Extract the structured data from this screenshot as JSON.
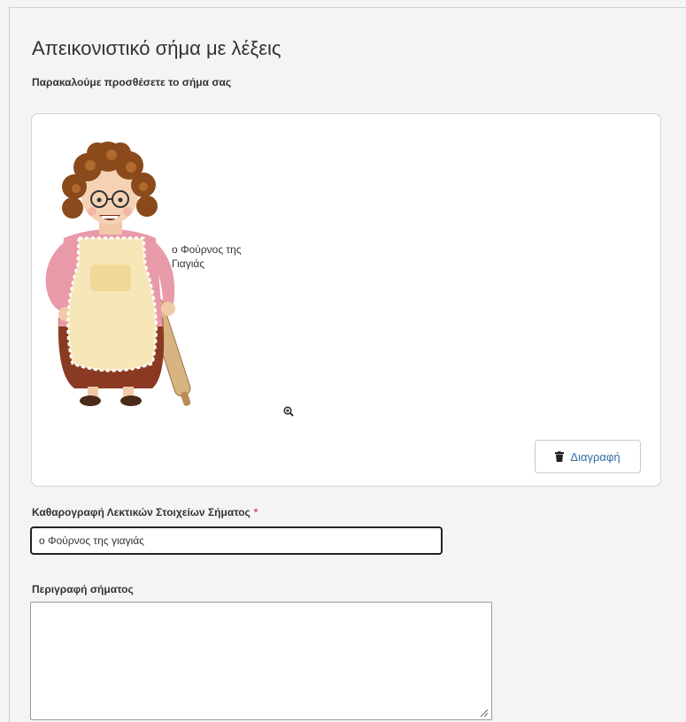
{
  "section": {
    "title": "Απεικονιστικό σήμα με λέξεις",
    "subtitle": "Παρακαλούμε προσθέσετε το σήμα σας"
  },
  "image_card": {
    "image_text_line1": "ο Φούρνος της",
    "image_text_line2": "Γιαγιάς",
    "zoom_icon": "zoom-in-icon",
    "delete_button": {
      "icon": "trash-icon",
      "label": "Διαγραφή"
    }
  },
  "transcription_field": {
    "label": "Καθαρογραφή Λεκτικών Στοιχείων Σήματος",
    "required_marker": "*",
    "value": "ο Φούρνος της γιαγιάς"
  },
  "description_field": {
    "label": "Περιγραφή σήματος",
    "value": ""
  },
  "colors": {
    "background": "#f4f4f4",
    "card": "#ffffff",
    "link_blue": "#2f6fa6",
    "required_red": "#d9534f"
  }
}
